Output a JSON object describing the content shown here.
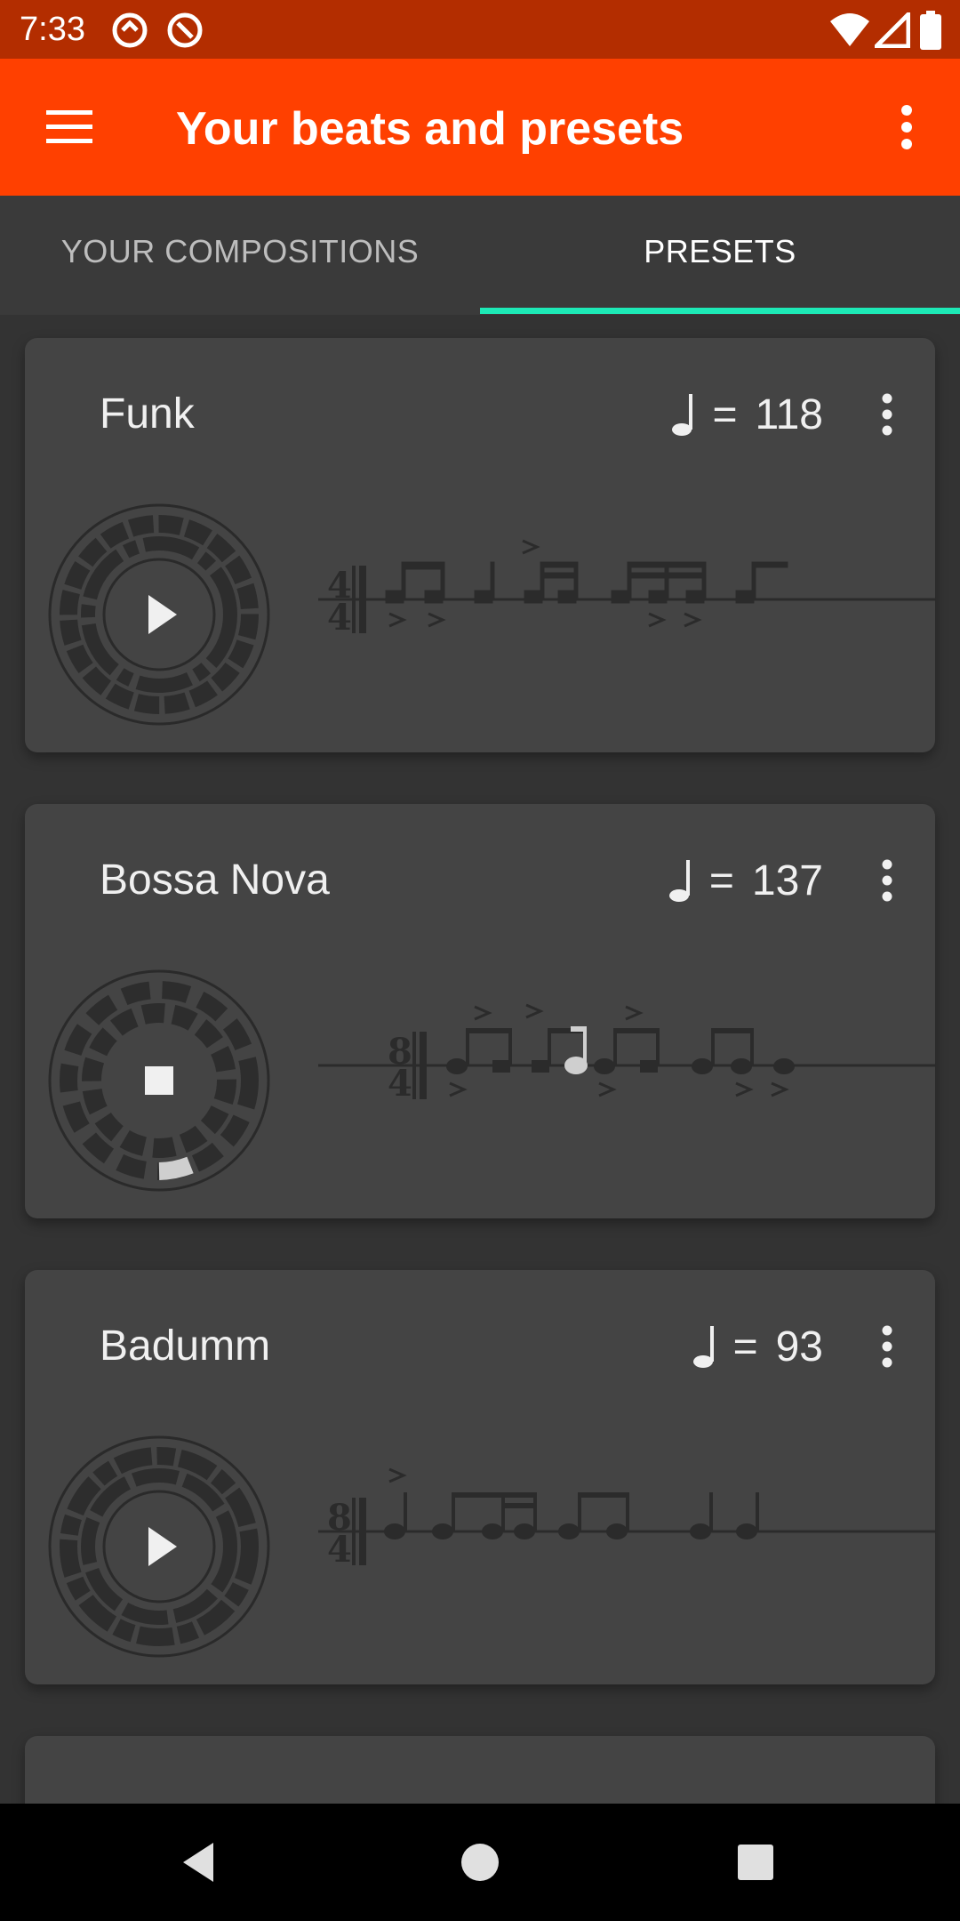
{
  "status_bar": {
    "time": "7:33",
    "icons": [
      "app-notification-icon",
      "app-notification-icon",
      "wifi-icon",
      "cell-signal-icon",
      "battery-icon"
    ]
  },
  "app_bar": {
    "title": "Your beats and presets",
    "menu_icon": "hamburger-menu-icon",
    "overflow_icon": "more-vert-icon"
  },
  "tabs": [
    {
      "label": "YOUR COMPOSITIONS",
      "selected": false
    },
    {
      "label": "PRESETS",
      "selected": true
    }
  ],
  "colors": {
    "status_bar": "#b32d00",
    "app_bar": "#ff4000",
    "tab_indicator": "#1de9b6",
    "card": "#444444",
    "background": "#333333"
  },
  "presets": [
    {
      "name": "Funk",
      "tempo_eq": "=",
      "tempo": "118",
      "state": "stopped",
      "control_icon": "play-icon",
      "time_signature": "4/4"
    },
    {
      "name": "Bossa Nova",
      "tempo_eq": "=",
      "tempo": "137",
      "state": "playing",
      "control_icon": "stop-icon",
      "time_signature": "8/4"
    },
    {
      "name": "Badumm",
      "tempo_eq": "=",
      "tempo": "93",
      "state": "stopped",
      "control_icon": "play-icon",
      "time_signature": "8/4"
    }
  ],
  "nav_bar": {
    "icons": [
      "back-icon",
      "home-icon",
      "recents-icon"
    ]
  }
}
